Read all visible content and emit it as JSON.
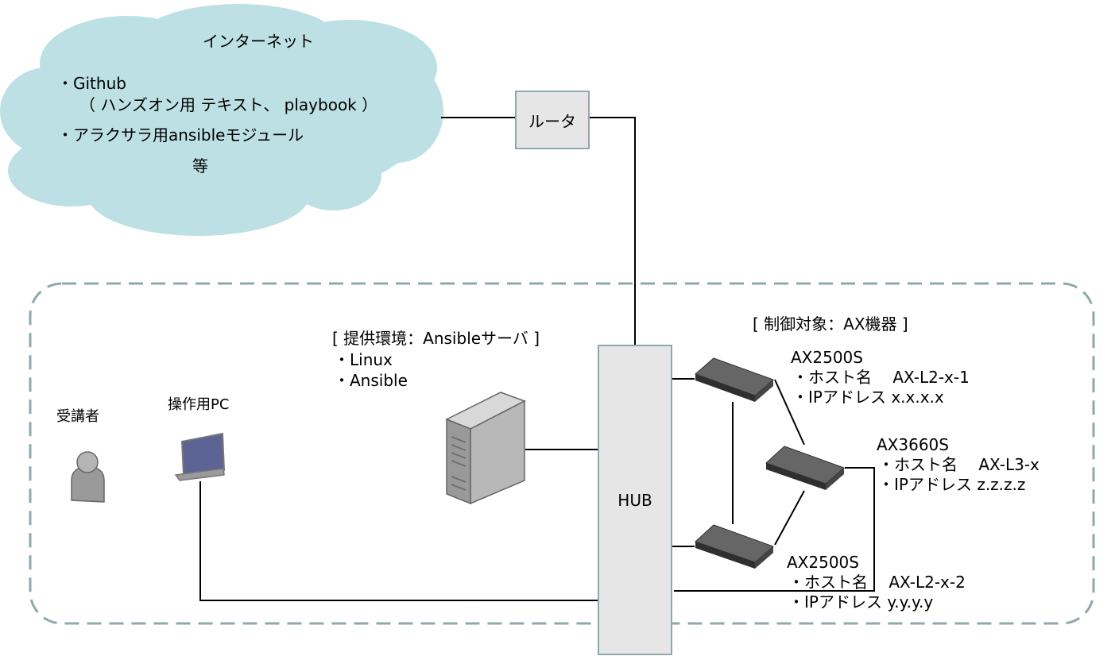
{
  "colors": {
    "cloud": "#bde0e4",
    "dashed_border": "#8fa8ac",
    "box_fill": "#e6e6e6",
    "line": "#000000"
  },
  "internet": {
    "title": "インターネット",
    "item1": "・Github",
    "item1_sub": "（ ハンズオン用 テキスト、 playbook ）",
    "item2": "・アラクサラ用ansibleモジュール",
    "etc": "等"
  },
  "router": {
    "label": "ルータ"
  },
  "hub": {
    "label": "HUB"
  },
  "server": {
    "heading": "[ 提供環境：Ansibleサーバ ]",
    "item1": "・Linux",
    "item2": "・Ansible"
  },
  "targets": {
    "heading": "[ 制御対象：AX機器 ]"
  },
  "switch1": {
    "model": "AX2500S",
    "host": "・ホスト名　 AX-L2-x-1",
    "ip": "・IPアドレス  x.x.x.x"
  },
  "switch3": {
    "model": "AX3660S",
    "host": "・ホスト名　 AX-L3-x",
    "ip": "・IPアドレス  z.z.z.z"
  },
  "switch2": {
    "model": "AX2500S",
    "host": "・ホスト名　 AX-L2-x-2",
    "ip": "・IPアドレス  y.y.y.y"
  },
  "student": {
    "label": "受講者"
  },
  "pc": {
    "label": "操作用PC"
  },
  "icons": [
    "cloud-icon",
    "server-tower-icon",
    "laptop-icon",
    "person-icon",
    "switch-icon"
  ]
}
